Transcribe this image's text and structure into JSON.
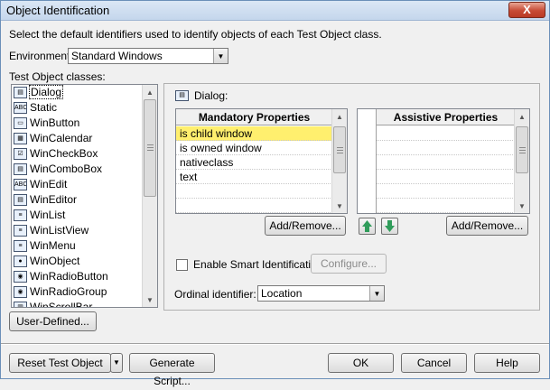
{
  "window": {
    "title": "Object Identification",
    "close_glyph": "X"
  },
  "description": "Select the default identifiers used to identify objects of each Test Object class.",
  "environment": {
    "label": "Environment:",
    "value": "Standard Windows"
  },
  "classes": {
    "label": "Test Object classes:",
    "items": [
      {
        "label": "Dialog",
        "icon": "dialog-icon",
        "glyph": "▤"
      },
      {
        "label": "Static",
        "icon": "static-icon",
        "glyph": "ABC"
      },
      {
        "label": "WinButton",
        "icon": "button-icon",
        "glyph": "▭"
      },
      {
        "label": "WinCalendar",
        "icon": "calendar-icon",
        "glyph": "▦"
      },
      {
        "label": "WinCheckBox",
        "icon": "checkbox-icon",
        "glyph": "☑"
      },
      {
        "label": "WinComboBox",
        "icon": "combobox-icon",
        "glyph": "▤"
      },
      {
        "label": "WinEdit",
        "icon": "edit-icon",
        "glyph": "ABC"
      },
      {
        "label": "WinEditor",
        "icon": "editor-icon",
        "glyph": "▤"
      },
      {
        "label": "WinList",
        "icon": "list-icon",
        "glyph": "≡"
      },
      {
        "label": "WinListView",
        "icon": "listview-icon",
        "glyph": "≡"
      },
      {
        "label": "WinMenu",
        "icon": "menu-icon",
        "glyph": "≡"
      },
      {
        "label": "WinObject",
        "icon": "object-icon",
        "glyph": "●"
      },
      {
        "label": "WinRadioButton",
        "icon": "radiobutton-icon",
        "glyph": "◉"
      },
      {
        "label": "WinRadioGroup",
        "icon": "radiogroup-icon",
        "glyph": "◉"
      },
      {
        "label": "WinScrollBar",
        "icon": "scrollbar-icon",
        "glyph": "▥"
      }
    ]
  },
  "selected_class": "Dialog:",
  "mandatory": {
    "header": "Mandatory Properties",
    "rows": [
      "is child window",
      "is owned window",
      "nativeclass",
      "text"
    ]
  },
  "assistive": {
    "header": "Assistive Properties"
  },
  "buttons": {
    "add_remove_mandatory": "Add/Remove...",
    "add_remove_assistive": "Add/Remove...",
    "configure": "Configure...",
    "user_defined": "User-Defined...",
    "reset": "Reset Test Object",
    "generate": "Generate Script...",
    "ok": "OK",
    "cancel": "Cancel",
    "help": "Help"
  },
  "smart_identification": {
    "label": "Enable Smart Identification:",
    "checked": false
  },
  "ordinal": {
    "label": "Ordinal identifier:",
    "value": "Location"
  },
  "colors": {
    "highlight": "#ffef6e",
    "arrow_green": "#2f9c5a"
  }
}
